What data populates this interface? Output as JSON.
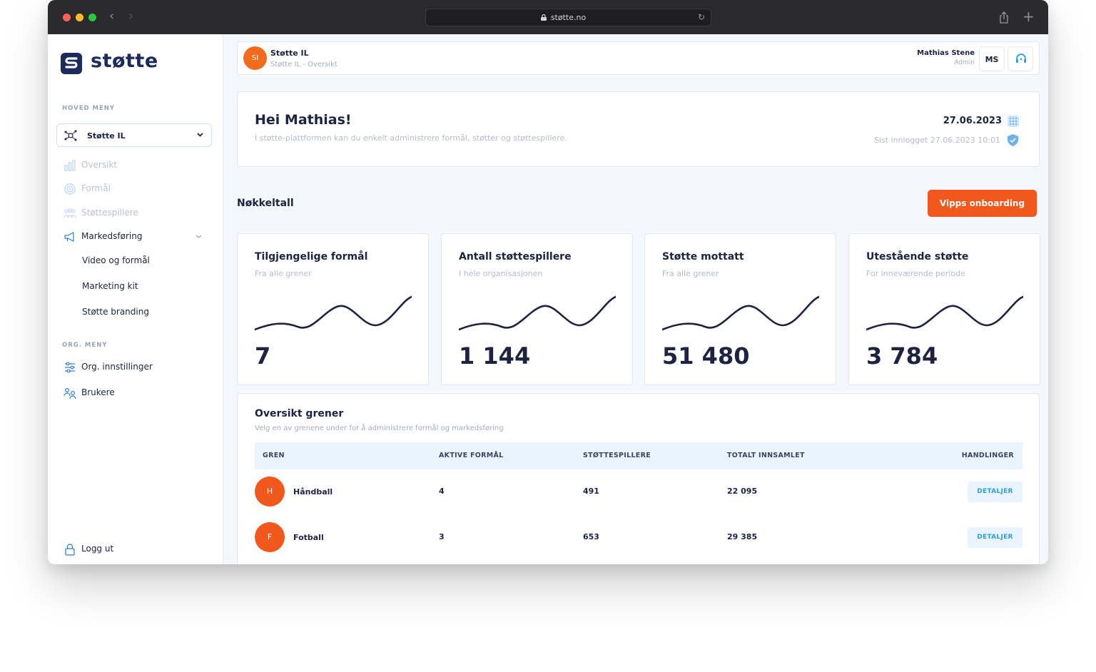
{
  "browser": {
    "url": "støtte.no"
  },
  "sidebar": {
    "logo_text": "støtte",
    "main_menu_label": "HOVED MENY",
    "org_select": "Støtte IL",
    "items": [
      {
        "label": "Oversikt"
      },
      {
        "label": "Formål"
      },
      {
        "label": "Støttespillere"
      },
      {
        "label": "Markedsføring"
      }
    ],
    "sub_items": [
      {
        "label": "Video og formål"
      },
      {
        "label": "Marketing kit"
      },
      {
        "label": "Støtte branding"
      }
    ],
    "org_menu_label": "ORG. MENY",
    "org_items": [
      {
        "label": "Org. innstillinger"
      },
      {
        "label": "Brukere"
      }
    ],
    "logout": "Logg ut"
  },
  "header": {
    "org_initials": "SI",
    "org_name": "Støtte IL",
    "breadcrumb": "Støtte IL - Oversikt",
    "user_name": "Mathias Stene",
    "user_role": "Admin",
    "user_initials": "MS"
  },
  "welcome": {
    "greeting": "Hei Mathias!",
    "description": "I støtte-plattformen kan du enkelt administrere formål, støtter og støttespillere.",
    "date": "27.06.2023",
    "last_login": "Sist innlogget 27.06.2023 10:01"
  },
  "kpi": {
    "title": "Nøkkeltall",
    "vipps_button": "Vipps onboarding",
    "cards": [
      {
        "title": "Tilgjengelige formål",
        "subtitle": "Fra alle grener",
        "value": "7"
      },
      {
        "title": "Antall støttespillere",
        "subtitle": "I hele organisasjonen",
        "value": "1 144"
      },
      {
        "title": "Støtte mottatt",
        "subtitle": "Fra alle grener",
        "value": "51 480"
      },
      {
        "title": "Utestående støtte",
        "subtitle": "For inneværende periode",
        "value": "3 784"
      }
    ]
  },
  "grener": {
    "title": "Oversikt grener",
    "subtitle": "Velg en av grenene under for å administrere formål og markedsføring",
    "columns": [
      "GREN",
      "AKTIVE FORMÅL",
      "STØTTESPILLERE",
      "TOTALT INNSAMLET",
      "HANDLINGER"
    ],
    "rows": [
      {
        "initial": "H",
        "name": "Håndball",
        "aktive": "4",
        "stotte": "491",
        "total": "22 095",
        "action": "DETALJER"
      },
      {
        "initial": "F",
        "name": "Fotball",
        "aktive": "3",
        "stotte": "653",
        "total": "29 385",
        "action": "DETALJER"
      }
    ]
  },
  "colors": {
    "accent": "#f2571c",
    "navy": "#1d2340",
    "light_blue": "#eaf4fe",
    "link_blue": "#2f9be0"
  }
}
